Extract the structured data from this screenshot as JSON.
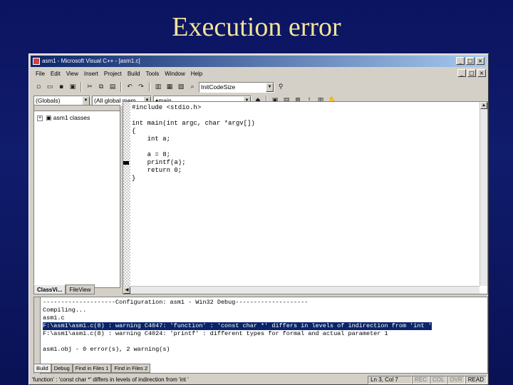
{
  "slide": {
    "title": "Execution error"
  },
  "window": {
    "title": "asm1 - Microsoft Visual C++ - [asm1.c]",
    "min": "_",
    "max": "□",
    "close": "×"
  },
  "menu": [
    "File",
    "Edit",
    "View",
    "Insert",
    "Project",
    "Build",
    "Tools",
    "Window",
    "Help"
  ],
  "toolbar": {
    "function_combo": "InitCodeSize",
    "scope_combo": "(Globals)",
    "members_combo": "(All global mem",
    "function2_combo": "main"
  },
  "left_pane": {
    "tree_root": "asm1 classes",
    "tabs": [
      "ClassVi...",
      "FileView"
    ]
  },
  "editor": {
    "lines": [
      "#include <stdio.h>",
      "",
      "int main(int argc, char *argv[])",
      "{",
      "    int a;",
      "",
      "    a = 8;",
      "    printf(a);",
      "    return 0;",
      "}"
    ]
  },
  "output": {
    "lines": [
      "--------------------Configuration: asm1 - Win32 Debug--------------------",
      "Compiling...",
      "asm1.c",
      "F:\\asm1\\asm1.c(8) : warning C4047: 'function' : 'const char *' differs in levels of indirection from 'int '",
      "F:\\asm1\\asm1.c(8) : warning C4024: 'printf' : different types for formal and actual parameter 1",
      "",
      "asm1.obj - 0 error(s), 2 warning(s)"
    ],
    "tabs": [
      "Build",
      "Debug",
      "Find in Files 1",
      "Find in Files 2"
    ]
  },
  "status": {
    "message": "'function' : 'const char *' differs in levels of indirection from 'int '",
    "position": "Ln 3, Col 7",
    "rec": "REC",
    "col": "COL",
    "ovr": "OVR",
    "read": "READ"
  }
}
